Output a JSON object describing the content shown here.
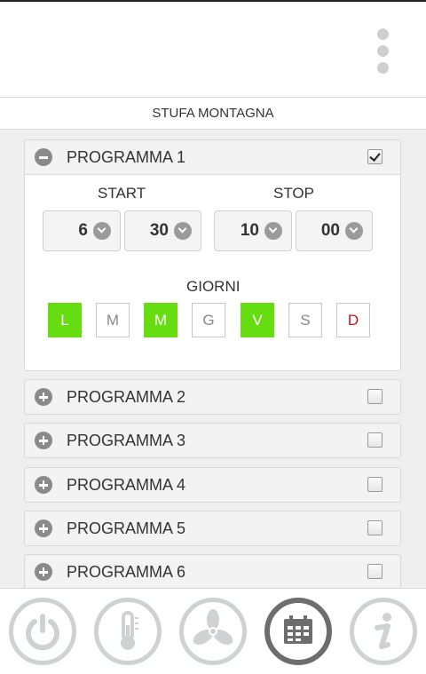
{
  "header": {
    "device_name": "STUFA MONTAGNA"
  },
  "programs": [
    {
      "title": "PROGRAMMA 1",
      "enabled": true,
      "start_label": "START",
      "stop_label": "STOP",
      "start_hour": "6",
      "start_minute": "30",
      "stop_hour": "10",
      "stop_minute": "00",
      "days_label": "GIORNI",
      "days": [
        {
          "label": "L",
          "active": true
        },
        {
          "label": "M",
          "active": false
        },
        {
          "label": "M",
          "active": true
        },
        {
          "label": "G",
          "active": false
        },
        {
          "label": "V",
          "active": true
        },
        {
          "label": "S",
          "active": false
        },
        {
          "label": "D",
          "active": false
        }
      ]
    },
    {
      "title": "PROGRAMMA 2",
      "enabled": false
    },
    {
      "title": "PROGRAMMA 3",
      "enabled": false
    },
    {
      "title": "PROGRAMMA 4",
      "enabled": false
    },
    {
      "title": "PROGRAMMA 5",
      "enabled": false
    },
    {
      "title": "PROGRAMMA 6",
      "enabled": false
    }
  ],
  "navbar": {
    "items": [
      "power-icon",
      "thermometer-icon",
      "fan-icon",
      "calendar-icon",
      "info-icon"
    ],
    "active": "calendar-icon"
  },
  "colors": {
    "day_active": "#66dd11",
    "sunday": "#cc1111",
    "nav_ring": "#cfd2d3",
    "nav_active_ring": "#6d6d6d"
  }
}
